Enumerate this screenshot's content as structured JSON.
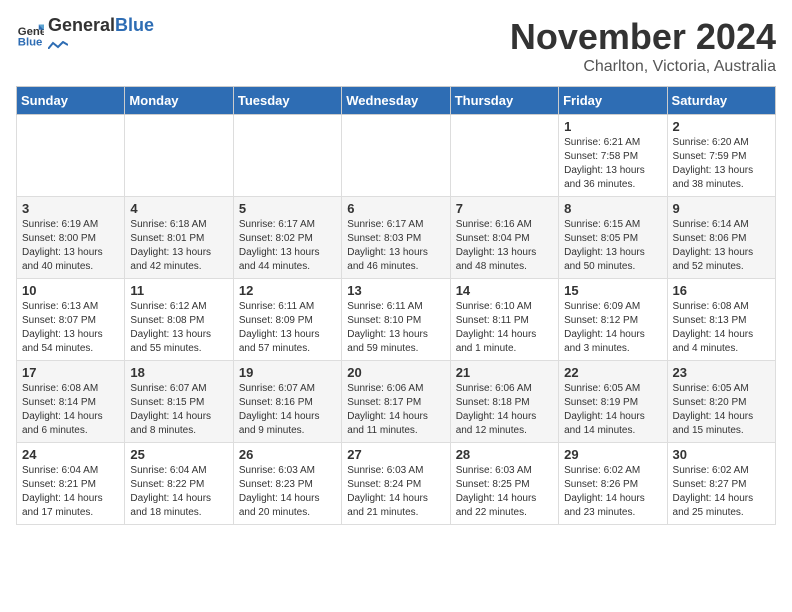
{
  "logo": {
    "text_general": "General",
    "text_blue": "Blue"
  },
  "header": {
    "month_year": "November 2024",
    "location": "Charlton, Victoria, Australia"
  },
  "days_of_week": [
    "Sunday",
    "Monday",
    "Tuesday",
    "Wednesday",
    "Thursday",
    "Friday",
    "Saturday"
  ],
  "weeks": [
    {
      "days": [
        {
          "num": "",
          "info": ""
        },
        {
          "num": "",
          "info": ""
        },
        {
          "num": "",
          "info": ""
        },
        {
          "num": "",
          "info": ""
        },
        {
          "num": "",
          "info": ""
        },
        {
          "num": "1",
          "info": "Sunrise: 6:21 AM\nSunset: 7:58 PM\nDaylight: 13 hours\nand 36 minutes."
        },
        {
          "num": "2",
          "info": "Sunrise: 6:20 AM\nSunset: 7:59 PM\nDaylight: 13 hours\nand 38 minutes."
        }
      ]
    },
    {
      "days": [
        {
          "num": "3",
          "info": "Sunrise: 6:19 AM\nSunset: 8:00 PM\nDaylight: 13 hours\nand 40 minutes."
        },
        {
          "num": "4",
          "info": "Sunrise: 6:18 AM\nSunset: 8:01 PM\nDaylight: 13 hours\nand 42 minutes."
        },
        {
          "num": "5",
          "info": "Sunrise: 6:17 AM\nSunset: 8:02 PM\nDaylight: 13 hours\nand 44 minutes."
        },
        {
          "num": "6",
          "info": "Sunrise: 6:17 AM\nSunset: 8:03 PM\nDaylight: 13 hours\nand 46 minutes."
        },
        {
          "num": "7",
          "info": "Sunrise: 6:16 AM\nSunset: 8:04 PM\nDaylight: 13 hours\nand 48 minutes."
        },
        {
          "num": "8",
          "info": "Sunrise: 6:15 AM\nSunset: 8:05 PM\nDaylight: 13 hours\nand 50 minutes."
        },
        {
          "num": "9",
          "info": "Sunrise: 6:14 AM\nSunset: 8:06 PM\nDaylight: 13 hours\nand 52 minutes."
        }
      ]
    },
    {
      "days": [
        {
          "num": "10",
          "info": "Sunrise: 6:13 AM\nSunset: 8:07 PM\nDaylight: 13 hours\nand 54 minutes."
        },
        {
          "num": "11",
          "info": "Sunrise: 6:12 AM\nSunset: 8:08 PM\nDaylight: 13 hours\nand 55 minutes."
        },
        {
          "num": "12",
          "info": "Sunrise: 6:11 AM\nSunset: 8:09 PM\nDaylight: 13 hours\nand 57 minutes."
        },
        {
          "num": "13",
          "info": "Sunrise: 6:11 AM\nSunset: 8:10 PM\nDaylight: 13 hours\nand 59 minutes."
        },
        {
          "num": "14",
          "info": "Sunrise: 6:10 AM\nSunset: 8:11 PM\nDaylight: 14 hours\nand 1 minute."
        },
        {
          "num": "15",
          "info": "Sunrise: 6:09 AM\nSunset: 8:12 PM\nDaylight: 14 hours\nand 3 minutes."
        },
        {
          "num": "16",
          "info": "Sunrise: 6:08 AM\nSunset: 8:13 PM\nDaylight: 14 hours\nand 4 minutes."
        }
      ]
    },
    {
      "days": [
        {
          "num": "17",
          "info": "Sunrise: 6:08 AM\nSunset: 8:14 PM\nDaylight: 14 hours\nand 6 minutes."
        },
        {
          "num": "18",
          "info": "Sunrise: 6:07 AM\nSunset: 8:15 PM\nDaylight: 14 hours\nand 8 minutes."
        },
        {
          "num": "19",
          "info": "Sunrise: 6:07 AM\nSunset: 8:16 PM\nDaylight: 14 hours\nand 9 minutes."
        },
        {
          "num": "20",
          "info": "Sunrise: 6:06 AM\nSunset: 8:17 PM\nDaylight: 14 hours\nand 11 minutes."
        },
        {
          "num": "21",
          "info": "Sunrise: 6:06 AM\nSunset: 8:18 PM\nDaylight: 14 hours\nand 12 minutes."
        },
        {
          "num": "22",
          "info": "Sunrise: 6:05 AM\nSunset: 8:19 PM\nDaylight: 14 hours\nand 14 minutes."
        },
        {
          "num": "23",
          "info": "Sunrise: 6:05 AM\nSunset: 8:20 PM\nDaylight: 14 hours\nand 15 minutes."
        }
      ]
    },
    {
      "days": [
        {
          "num": "24",
          "info": "Sunrise: 6:04 AM\nSunset: 8:21 PM\nDaylight: 14 hours\nand 17 minutes."
        },
        {
          "num": "25",
          "info": "Sunrise: 6:04 AM\nSunset: 8:22 PM\nDaylight: 14 hours\nand 18 minutes."
        },
        {
          "num": "26",
          "info": "Sunrise: 6:03 AM\nSunset: 8:23 PM\nDaylight: 14 hours\nand 20 minutes."
        },
        {
          "num": "27",
          "info": "Sunrise: 6:03 AM\nSunset: 8:24 PM\nDaylight: 14 hours\nand 21 minutes."
        },
        {
          "num": "28",
          "info": "Sunrise: 6:03 AM\nSunset: 8:25 PM\nDaylight: 14 hours\nand 22 minutes."
        },
        {
          "num": "29",
          "info": "Sunrise: 6:02 AM\nSunset: 8:26 PM\nDaylight: 14 hours\nand 23 minutes."
        },
        {
          "num": "30",
          "info": "Sunrise: 6:02 AM\nSunset: 8:27 PM\nDaylight: 14 hours\nand 25 minutes."
        }
      ]
    }
  ]
}
